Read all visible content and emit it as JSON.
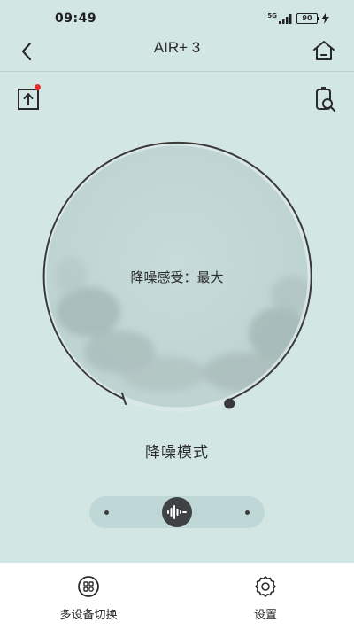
{
  "status_bar": {
    "time": "09:49",
    "network": "5G",
    "battery": "90"
  },
  "header": {
    "title": "AIR+ 3"
  },
  "dial": {
    "label": "降噪感受：最大"
  },
  "mode": {
    "label": "降噪模式"
  },
  "bottom_nav": {
    "items": [
      {
        "label": "多设备切换"
      },
      {
        "label": "设置"
      }
    ]
  },
  "colors": {
    "background": "#d2e6e4",
    "knob": "#3f4244",
    "badge": "#e53030"
  }
}
